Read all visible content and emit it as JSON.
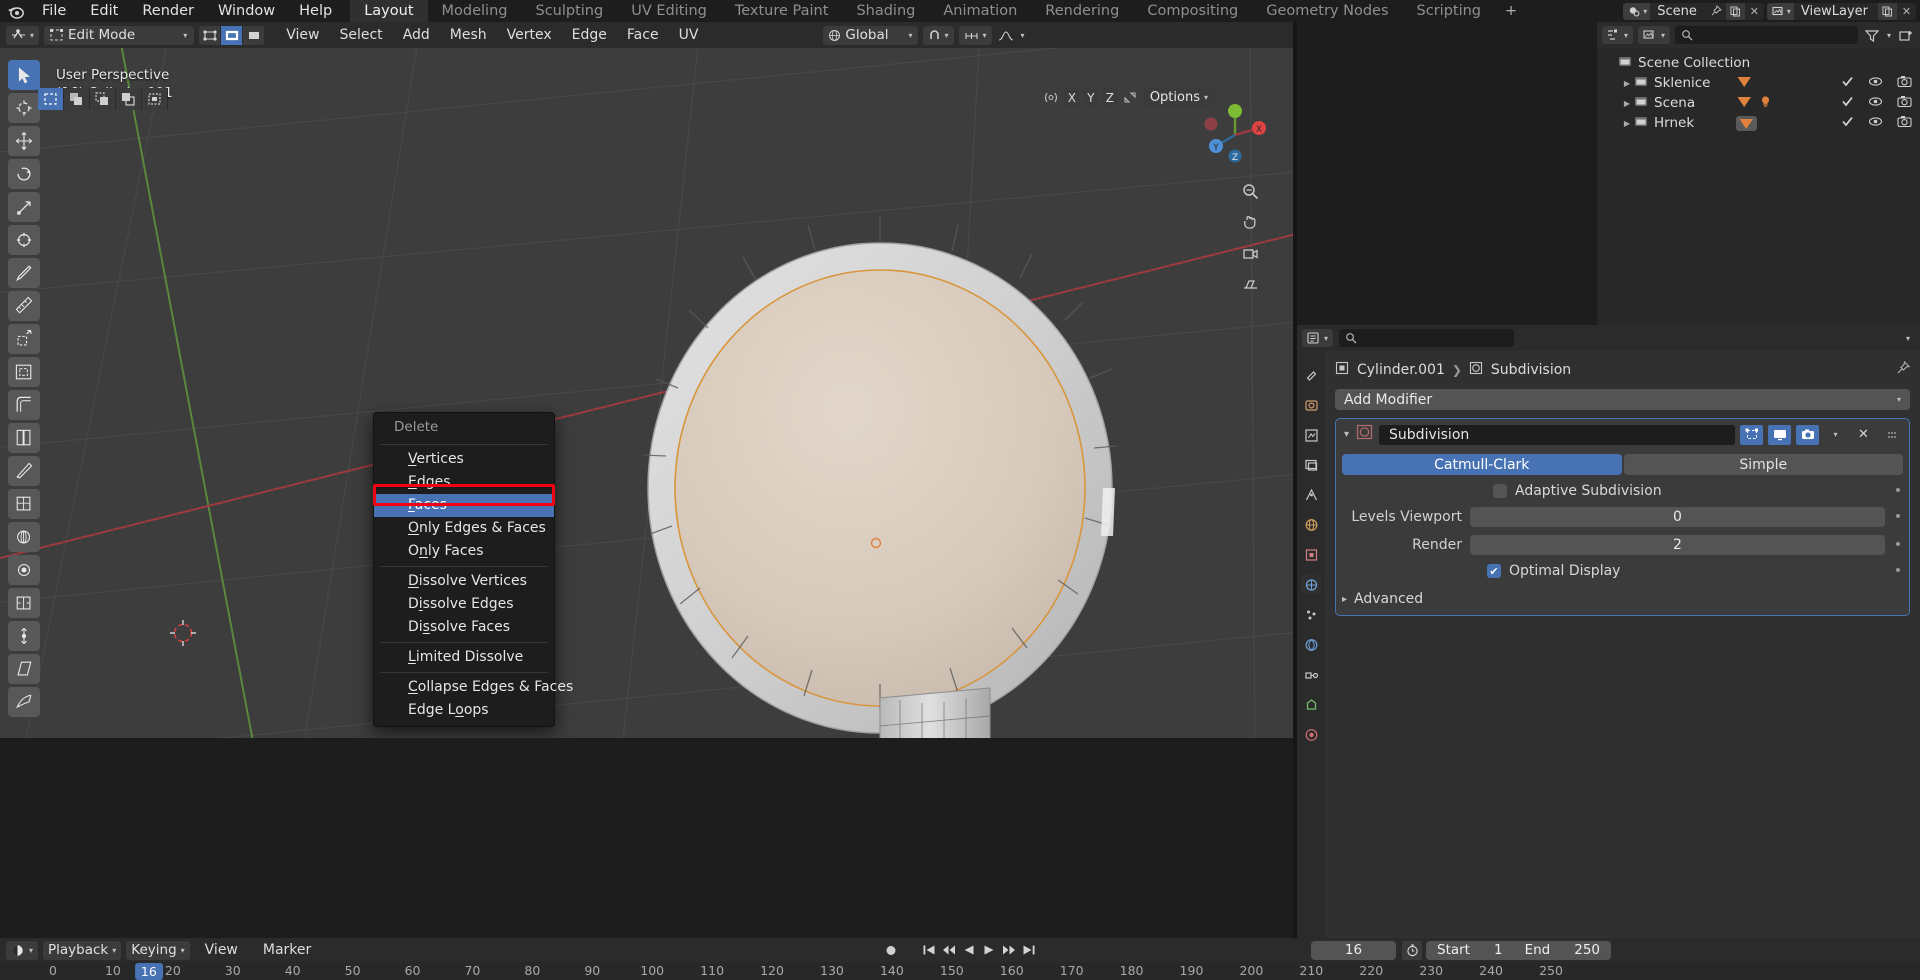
{
  "app": {
    "logo_icon": "blender-logo"
  },
  "topbar": {
    "menus": [
      "File",
      "Edit",
      "Render",
      "Window",
      "Help"
    ],
    "workspaces": [
      "Layout",
      "Modeling",
      "Sculpting",
      "UV Editing",
      "Texture Paint",
      "Shading",
      "Animation",
      "Rendering",
      "Compositing",
      "Geometry Nodes",
      "Scripting"
    ],
    "workspace_active": "Layout",
    "add_workspace_label": "+",
    "scene_name": "Scene",
    "viewlayer_name": "ViewLayer",
    "scene_icon": "scene-icon",
    "viewlayer_icon": "viewlayer-icon",
    "pin_icon": "pin-icon",
    "copy_icon": "copy-icon",
    "close_icon": "x-icon"
  },
  "viewport_header": {
    "editor_type_icon": "editor-type-icon",
    "mode": "Edit Mode",
    "mode_icon": "edit-mode-icon",
    "select_modes": [
      "vertex-select-icon",
      "edge-select-icon",
      "face-select-icon"
    ],
    "select_mode_active_index": 1,
    "menus": [
      "View",
      "Select",
      "Add",
      "Mesh",
      "Vertex",
      "Edge",
      "Face",
      "UV"
    ],
    "transform_orientation": "Global",
    "orientation_icon": "orientation-icon",
    "snap_icon": "magnet-icon",
    "snap_target_icon": "snap-increment-icon",
    "proportional_icon": "proportional-edit-icon",
    "visibility_icon": "object-visibility-icon",
    "gizmo_icon": "gizmo-icon",
    "overlays_icon": "overlays-icon",
    "xray_icon": "xray-icon",
    "shading_modes": [
      "wireframe-shading-icon",
      "solid-shading-icon",
      "material-shading-icon",
      "rendered-shading-icon"
    ],
    "shading_active_index": 1
  },
  "viewport_subheader": {
    "tool_options": [
      "tweak-select-icon",
      "select-box-icon",
      "select-circle-icon",
      "select-lasso-icon",
      "select-all-icon"
    ],
    "tool_active_index": 0,
    "mesh_filter_icon": "mesh-filter-icon",
    "axis_locks": [
      "X",
      "Y",
      "Z"
    ],
    "mirror_icon": "mirror-icon",
    "options_label": "Options"
  },
  "viewport": {
    "perspective": "User Perspective",
    "active_object": "(16) Cylinder.001",
    "gizmo_axes": [
      "X",
      "Y",
      "Z"
    ],
    "nav_buttons": [
      "zoom-icon",
      "pan-icon",
      "camera-view-icon",
      "toggle-ortho-icon"
    ]
  },
  "toolbar": {
    "tools": [
      "tweak-tool-icon",
      "cursor-tool-icon",
      "move-tool-icon",
      "rotate-tool-icon",
      "scale-tool-icon",
      "transform-tool-icon",
      "annotate-tool-icon",
      "measure-tool-icon",
      "extrude-region-tool-icon",
      "inset-faces-tool-icon",
      "bevel-tool-icon",
      "loop-cut-tool-icon",
      "knife-tool-icon",
      "poly-build-tool-icon",
      "spin-tool-icon",
      "smooth-tool-icon",
      "edge-slide-tool-icon",
      "shrink-fatten-tool-icon",
      "shear-tool-icon",
      "rip-region-tool-icon"
    ],
    "active_index": 0
  },
  "delete_menu": {
    "title": "Delete",
    "groups": [
      [
        {
          "label": "Vertices",
          "accel": "V"
        },
        {
          "label": "Edges",
          "accel": "E"
        },
        {
          "label": "Faces",
          "accel": "F",
          "selected": true
        },
        {
          "label": "Only Edges & Faces",
          "accel": "O"
        },
        {
          "label": "Only Faces",
          "accel": "n"
        }
      ],
      [
        {
          "label": "Dissolve Vertices",
          "accel": "D"
        },
        {
          "label": "Dissolve Edges",
          "accel": "i"
        },
        {
          "label": "Dissolve Faces",
          "accel": "s"
        }
      ],
      [
        {
          "label": "Limited Dissolve",
          "accel": "L"
        }
      ],
      [
        {
          "label": "Collapse Edges & Faces",
          "accel": "C"
        },
        {
          "label": "Edge Loops",
          "accel": "o"
        }
      ]
    ],
    "highlight_color": "#f00212",
    "selection_color": "#4772b3"
  },
  "outliner": {
    "display_mode_icon": "outliner-display-mode-icon",
    "filter_id_icon": "filter-id-icon",
    "search_icon": "search-icon",
    "filter_icon": "filter-icon",
    "new_collection_icon": "new-collection-icon",
    "root": "Scene Collection",
    "items": [
      {
        "name": "Sklenice",
        "type_icon": "collection-icon",
        "data_icons": [
          "mesh-data-icon"
        ],
        "checkbox": true,
        "eye": "eye-icon",
        "camera": "camera-icon"
      },
      {
        "name": "Scena",
        "type_icon": "collection-icon",
        "data_icons": [
          "mesh-data-icon",
          "light-data-icon"
        ],
        "checkbox": true,
        "eye": "eye-icon",
        "camera": "camera-icon"
      },
      {
        "name": "Hrnek",
        "type_icon": "collection-icon",
        "data_icons": [
          "mesh-data-icon"
        ],
        "checkbox": true,
        "eye": "eye-icon",
        "camera": "camera-icon",
        "highlighted": true
      }
    ]
  },
  "properties": {
    "editor_icon": "properties-editor-icon",
    "search_icon": "search-icon",
    "tabs": [
      "tool-tab-icon",
      "render-tab-icon",
      "output-tab-icon",
      "view-layer-tab-icon",
      "scene-tab-icon",
      "world-tab-icon",
      "object-tab-icon",
      "modifier-tab-icon",
      "particles-tab-icon",
      "physics-tab-icon",
      "constraints-tab-icon",
      "data-tab-icon",
      "material-tab-icon"
    ],
    "active_tab_index": 7,
    "breadcrumb_object": "Cylinder.001",
    "breadcrumb_modifier": "Subdivision",
    "breadcrumb_object_icon": "object-icon",
    "breadcrumb_modifier_icon": "modifier-icon",
    "pin_icon": "pin-icon",
    "add_modifier_label": "Add Modifier",
    "modifier": {
      "expand_icon": "chevron-down-icon",
      "type_icon": "subsurf-modifier-icon",
      "name": "Subdivision",
      "display_toggles": [
        "edit-mode-display-icon",
        "realtime-display-icon",
        "render-display-icon"
      ],
      "dropdown_icon": "chevron-down-icon",
      "close_icon": "x-icon",
      "drag_icon": "drag-handle-icon",
      "algorithm_options": [
        "Catmull-Clark",
        "Simple"
      ],
      "algorithm_active": "Catmull-Clark",
      "adaptive_subdivision_label": "Adaptive Subdivision",
      "adaptive_subdivision_checked": false,
      "levels_viewport_label": "Levels Viewport",
      "levels_viewport_value": "0",
      "render_label": "Render",
      "render_value": "2",
      "optimal_display_label": "Optimal Display",
      "optimal_display_checked": true,
      "advanced_label": "Advanced",
      "advanced_expand_icon": "chevron-right-icon"
    }
  },
  "timeline": {
    "editor_icon": "timeline-editor-icon",
    "menus": [
      "Playback",
      "Keying",
      "View",
      "Marker"
    ],
    "playback_has_dropdown": true,
    "keying_has_dropdown": true,
    "transport": [
      "jump-start-icon",
      "prev-keyframe-icon",
      "play-reverse-icon",
      "play-icon",
      "next-keyframe-icon",
      "jump-end-icon"
    ],
    "record_icon": "record-icon",
    "current_frame": "16",
    "auto_key_icon": "auto-keying-icon",
    "start_label": "Start",
    "start_value": "1",
    "end_label": "End",
    "end_value": "250",
    "ruler_ticks": [
      "0",
      "10",
      "20",
      "30",
      "40",
      "50",
      "60",
      "70",
      "80",
      "90",
      "100",
      "110",
      "120",
      "130",
      "140",
      "150",
      "160",
      "170",
      "180",
      "190",
      "200",
      "210",
      "220",
      "230",
      "240",
      "250"
    ],
    "playhead_frame": "16"
  },
  "colors": {
    "accent_blue": "#4772b3",
    "highlight_red": "#f00212",
    "orange": "#e0823d",
    "viewport_bg": "#3d3d3d",
    "panel_bg": "#303030",
    "header_bg": "#2b2b2b",
    "outliner_bg": "#282828"
  }
}
